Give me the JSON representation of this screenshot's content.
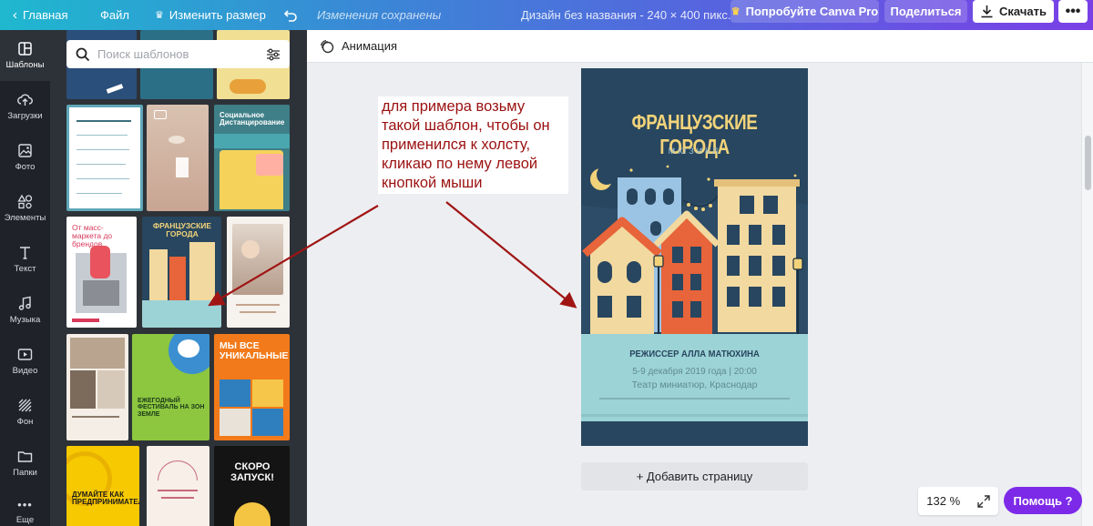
{
  "topbar": {
    "home": "Главная",
    "file": "Файл",
    "resize": "Изменить размер",
    "saved_status": "Изменения сохранены",
    "design_title": "Дизайн без названия - 240 × 400 пикс.",
    "try_pro": "Попробуйте Canva Pro",
    "share": "Поделиться",
    "download": "Скачать"
  },
  "rail": {
    "items": [
      {
        "label": "Шаблоны",
        "icon": "templates-icon"
      },
      {
        "label": "Загрузки",
        "icon": "upload-icon"
      },
      {
        "label": "Фото",
        "icon": "photo-icon"
      },
      {
        "label": "Элементы",
        "icon": "elements-icon"
      },
      {
        "label": "Текст",
        "icon": "text-icon"
      },
      {
        "label": "Музыка",
        "icon": "music-icon"
      },
      {
        "label": "Видео",
        "icon": "video-icon"
      },
      {
        "label": "Фон",
        "icon": "background-icon"
      },
      {
        "label": "Папки",
        "icon": "folder-icon"
      },
      {
        "label": "Еще",
        "icon": "more-icon"
      }
    ]
  },
  "panel": {
    "search_placeholder": "Поиск шаблонов",
    "templates": {
      "social": "Социальное Дистанцирование",
      "city": "ФРАНЦУЗСКИЕ ГОРОДА",
      "brands": "От масс-маркета до брендов",
      "festival": "ЕЖЕГОДНЫЙ ФЕСТИВАЛЬ НА ЗОН ЗЕМЛЕ",
      "unique": "МЫ ВСЕ УНИКАЛЬНЫЕ",
      "entrepreneur": "ДУМАЙТЕ КАК ПРЕДПРИНИМАТЕЛЬ",
      "launch": "СКОРО ЗАПУСК!"
    }
  },
  "workspace": {
    "animation_label": "Анимация",
    "annotation": "для примера возьму такой шаблон, чтобы он применился к холсту, кликаю по нему левой кнопкой мыши",
    "add_page": "+ Добавить страницу",
    "zoom": "132 %",
    "help": "Помощь ?"
  },
  "design": {
    "title": "ФРАНЦУЗСКИЕ ГОРОДА",
    "subtitle": "МЮЗИКЛ",
    "director": "РЕЖИССЕР АЛЛА МАТЮХИНА",
    "date": "5-9 декабря 2019 года | 20:00",
    "venue": "Театр миниатюр, Краснодар"
  },
  "colors": {
    "accent": "#7d2ae8",
    "sky": "#28465f",
    "panel": "#2d3238",
    "annotation": "#9b1010"
  }
}
